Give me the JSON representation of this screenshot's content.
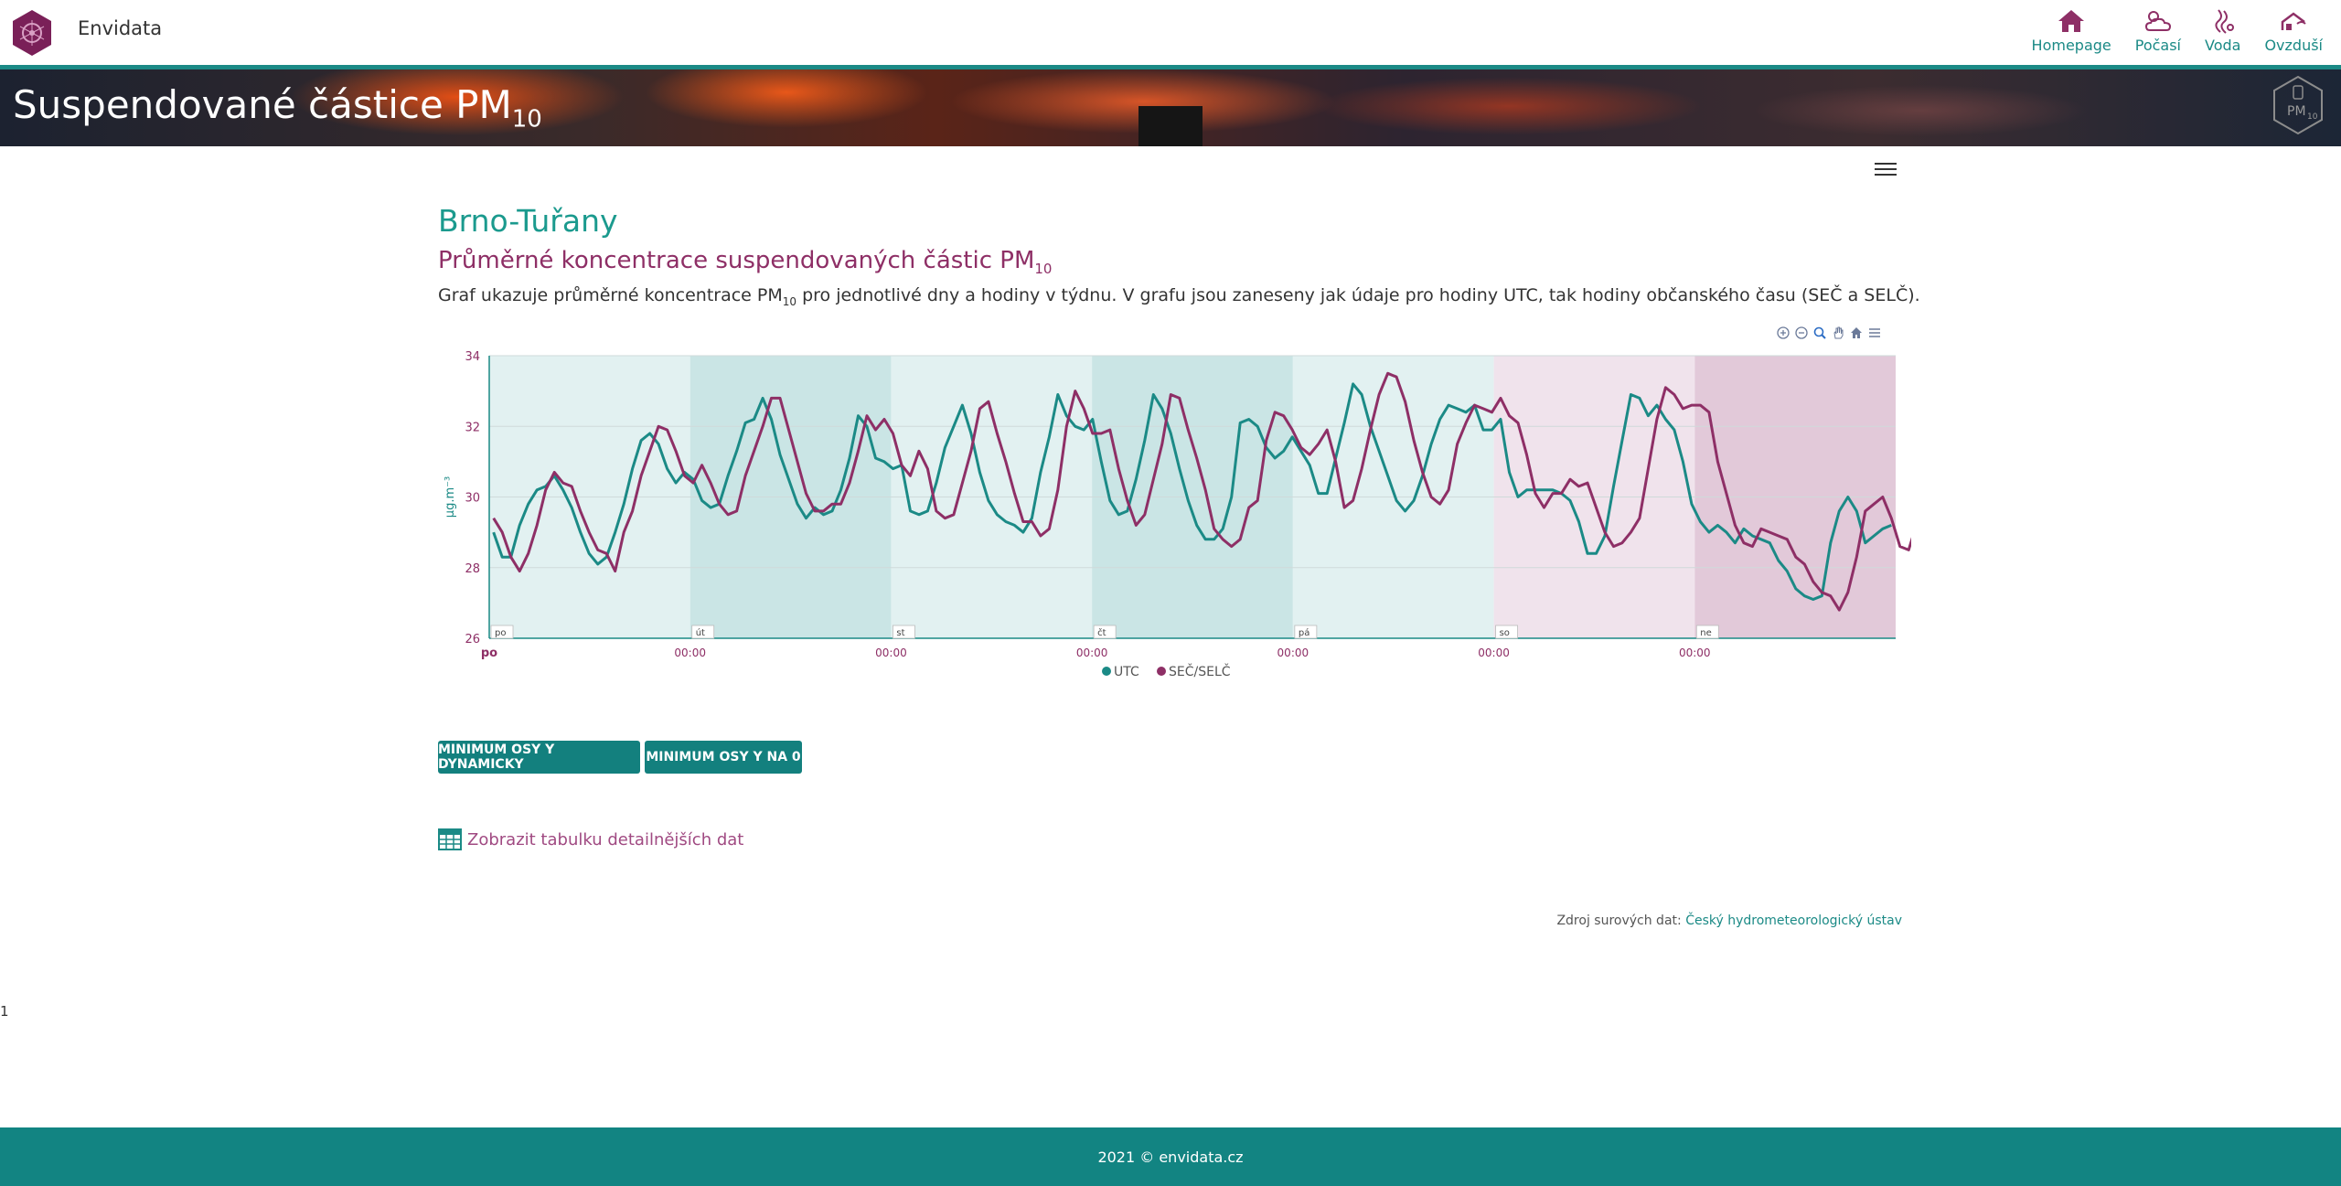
{
  "header": {
    "brand": "Envidata",
    "nav": [
      {
        "label": "Homepage",
        "icon": "home-icon"
      },
      {
        "label": "Počasí",
        "icon": "weather-icon"
      },
      {
        "label": "Voda",
        "icon": "water-icon"
      },
      {
        "label": "Ovzduší",
        "icon": "air-icon"
      }
    ]
  },
  "banner": {
    "title": "Suspendované částice PM",
    "title_sub": "10",
    "badge": "PM",
    "badge_sub": "10"
  },
  "page": {
    "station": "Brno-Tuřany",
    "subtitle": "Průměrné koncentrace suspendovaných částic PM",
    "subtitle_sub": "10",
    "desc_before": "Graf ukazuje průměrné koncentrace PM",
    "desc_sub": "10",
    "desc_after": " pro jednotlivé dny a hodiny v týdnu. V grafu jsou zaneseny jak údaje pro hodiny UTC, tak hodiny občanského času (SEČ a SELČ)."
  },
  "buttons": {
    "dynamic": "MINIMUM OSY Y DYNAMICKY",
    "zero": "MINIMUM OSY Y NA 0"
  },
  "table_link": "Zobrazit tabulku detailnějších dat",
  "source": {
    "prefix": "Zdroj surových dat: ",
    "link": "Český hydrometeorologický ústav"
  },
  "stray_text": "1",
  "footer": "2021 © envidata.cz",
  "colors": {
    "teal": "#1b8a86",
    "purple": "#8e2f66",
    "weekday_band_light": "#e2f1f1",
    "weekday_band_dark": "#cae5e5",
    "weekend_band_light": "#f0e3ec",
    "weekend_band_dark": "#e2c9d9"
  },
  "chart_data": {
    "type": "line",
    "ylabel": "µg.m⁻³",
    "ylim": [
      26,
      34
    ],
    "yticks": [
      26,
      28,
      30,
      32,
      34
    ],
    "day_labels": [
      "po",
      "út",
      "st",
      "čt",
      "pá",
      "so",
      "ne"
    ],
    "x_tick_labels": [
      "po",
      "00:00",
      "00:00",
      "00:00",
      "00:00",
      "00:00",
      "00:00"
    ],
    "legend": [
      "UTC",
      "SEČ/SELČ"
    ],
    "series": [
      {
        "name": "UTC",
        "color": "#1b8a86",
        "values": [
          29.0,
          28.3,
          28.3,
          29.2,
          29.8,
          30.2,
          30.3,
          30.6,
          30.2,
          29.7,
          29.0,
          28.4,
          28.1,
          28.3,
          29.0,
          29.8,
          30.8,
          31.6,
          31.8,
          31.5,
          30.8,
          30.4,
          30.7,
          30.5,
          29.9,
          29.7,
          29.8,
          30.6,
          31.3,
          32.1,
          32.2,
          32.8,
          32.2,
          31.2,
          30.5,
          29.8,
          29.4,
          29.7,
          29.5,
          29.6,
          30.2,
          31.1,
          32.3,
          32.0,
          31.1,
          31.0,
          30.8,
          30.9,
          29.6,
          29.5,
          29.6,
          30.4,
          31.4,
          32.0,
          32.6,
          31.8,
          30.7,
          29.9,
          29.5,
          29.3,
          29.2,
          29.0,
          29.4,
          30.7,
          31.7,
          32.9,
          32.3,
          32.0,
          31.9,
          32.2,
          31.0,
          29.9,
          29.5,
          29.6,
          30.5,
          31.6,
          32.9,
          32.5,
          31.8,
          30.8,
          29.9,
          29.2,
          28.8,
          28.8,
          29.1,
          30.0,
          32.1,
          32.2,
          32.0,
          31.4,
          31.1,
          31.3,
          31.7,
          31.3,
          30.9,
          30.1,
          30.1,
          31.1,
          32.1,
          33.2,
          32.9,
          32.0,
          31.3,
          30.6,
          29.9,
          29.6,
          29.9,
          30.6,
          31.5,
          32.2,
          32.6,
          32.5,
          32.4,
          32.6,
          31.9,
          31.9,
          32.2,
          30.7,
          30.0,
          30.2,
          30.2,
          30.2,
          30.2,
          30.1,
          29.9,
          29.3,
          28.4,
          28.4,
          28.9,
          30.3,
          31.6,
          32.9,
          32.8,
          32.3,
          32.6,
          32.2,
          31.9,
          31.0,
          29.8,
          29.3,
          29.0,
          29.2,
          29.0,
          28.7,
          29.1,
          28.9,
          28.8,
          28.7,
          28.2,
          27.9,
          27.4,
          27.2,
          27.1,
          27.2,
          28.7,
          29.6,
          30.0,
          29.6,
          28.7,
          28.9,
          29.1,
          29.2
        ]
      },
      {
        "name": "SEČ/SELČ",
        "color": "#8e2f66",
        "values": [
          29.4,
          29.0,
          28.3,
          27.9,
          28.4,
          29.2,
          30.2,
          30.7,
          30.4,
          30.3,
          29.6,
          29.0,
          28.5,
          28.4,
          27.9,
          29.0,
          29.6,
          30.6,
          31.3,
          32.0,
          31.9,
          31.3,
          30.6,
          30.4,
          30.9,
          30.4,
          29.8,
          29.5,
          29.6,
          30.6,
          31.3,
          32.0,
          32.8,
          32.8,
          31.9,
          31.0,
          30.1,
          29.6,
          29.6,
          29.8,
          29.8,
          30.4,
          31.3,
          32.3,
          31.9,
          32.2,
          31.8,
          30.9,
          30.6,
          31.3,
          30.8,
          29.6,
          29.4,
          29.5,
          30.4,
          31.3,
          32.5,
          32.7,
          31.8,
          31.0,
          30.1,
          29.3,
          29.3,
          28.9,
          29.1,
          30.2,
          32.0,
          33.0,
          32.5,
          31.8,
          31.8,
          31.9,
          30.8,
          29.9,
          29.2,
          29.5,
          30.5,
          31.5,
          32.9,
          32.8,
          31.9,
          31.1,
          30.2,
          29.1,
          28.8,
          28.6,
          28.8,
          29.7,
          29.9,
          31.6,
          32.4,
          32.3,
          31.9,
          31.4,
          31.2,
          31.5,
          31.9,
          31.0,
          29.7,
          29.9,
          30.8,
          31.9,
          32.9,
          33.5,
          33.4,
          32.7,
          31.6,
          30.7,
          30.0,
          29.8,
          30.2,
          31.5,
          32.1,
          32.6,
          32.5,
          32.4,
          32.8,
          32.3,
          32.1,
          31.2,
          30.1,
          29.7,
          30.1,
          30.1,
          30.5,
          30.3,
          30.4,
          29.7,
          29.0,
          28.6,
          28.7,
          29.0,
          29.4,
          30.8,
          32.2,
          33.1,
          32.9,
          32.5,
          32.6,
          32.6,
          32.4,
          31.0,
          30.1,
          29.2,
          28.7,
          28.6,
          29.1,
          29.0,
          28.9,
          28.8,
          28.3,
          28.1,
          27.6,
          27.3,
          27.2,
          26.8,
          27.3,
          28.3,
          29.6,
          29.8,
          30.0,
          29.4,
          28.6,
          28.5,
          29.3
        ]
      }
    ]
  }
}
